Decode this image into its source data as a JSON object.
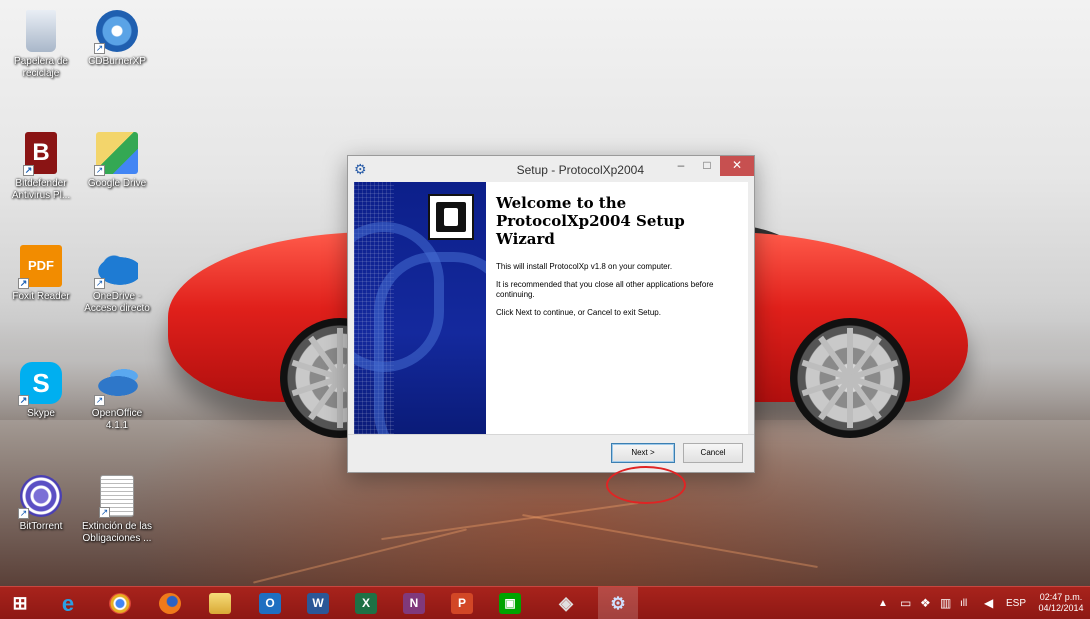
{
  "desktop_icons": [
    {
      "label": "Papelera de reciclaje",
      "icon": "recycle-bin-icon"
    },
    {
      "label": "CDBurnerXP",
      "icon": "cd-burner-icon"
    },
    {
      "label": "Bitdefender Antivirus Pl...",
      "icon": "bitdefender-icon"
    },
    {
      "label": "Google Drive",
      "icon": "google-drive-icon"
    },
    {
      "label": "Foxit Reader",
      "icon": "foxit-pdf-icon"
    },
    {
      "label": "OneDrive - Acceso directo",
      "icon": "onedrive-cloud-icon"
    },
    {
      "label": "Skype",
      "icon": "skype-icon"
    },
    {
      "label": "OpenOffice 4.1.1",
      "icon": "openoffice-icon"
    },
    {
      "label": "BitTorrent",
      "icon": "bittorrent-icon"
    },
    {
      "label": "Extinción de las Obligaciones ...",
      "icon": "document-icon"
    }
  ],
  "setup_window": {
    "title": "Setup - ProtocolXp2004",
    "controls": {
      "minimize": "–",
      "maximize": "□",
      "close": "✕"
    },
    "heading": "Welcome to the ProtocolXp2004 Setup Wizard",
    "paragraphs": [
      "This will install ProtocolXp v1.8 on your computer.",
      "It is recommended that you close all other applications before continuing.",
      "Click Next to continue, or Cancel to exit Setup."
    ],
    "next_label": "Next >",
    "cancel_label": "Cancel"
  },
  "taskbar": {
    "apps": [
      {
        "name": "windows-start",
        "glyph": "⊞",
        "color": "#ffffff"
      },
      {
        "name": "internet-explorer",
        "glyph": "e",
        "color": "#2a9fe3"
      },
      {
        "name": "chrome",
        "glyph": "●",
        "color": "#e8b024"
      },
      {
        "name": "firefox",
        "glyph": "◉",
        "color": "#e86a1c"
      },
      {
        "name": "file-explorer",
        "glyph": "▤",
        "color": "#e9c24c"
      },
      {
        "name": "outlook",
        "glyph": "O",
        "color": "#1f6fc1"
      },
      {
        "name": "word",
        "glyph": "W",
        "color": "#2b5797"
      },
      {
        "name": "excel",
        "glyph": "X",
        "color": "#1e7145"
      },
      {
        "name": "onenote",
        "glyph": "N",
        "color": "#80397b"
      },
      {
        "name": "powerpoint",
        "glyph": "P",
        "color": "#d24726"
      },
      {
        "name": "store",
        "glyph": "▣",
        "color": "#00a300"
      },
      {
        "name": "maps-tool",
        "glyph": "◈",
        "color": "#c9c9c9"
      },
      {
        "name": "setup-installer",
        "glyph": "⚙",
        "color": "#6a8fd1"
      }
    ],
    "tray": {
      "expand": "▲",
      "language": "ESP"
    },
    "clock": {
      "time": "02:47 p.m.",
      "date": "04/12/2014"
    }
  }
}
